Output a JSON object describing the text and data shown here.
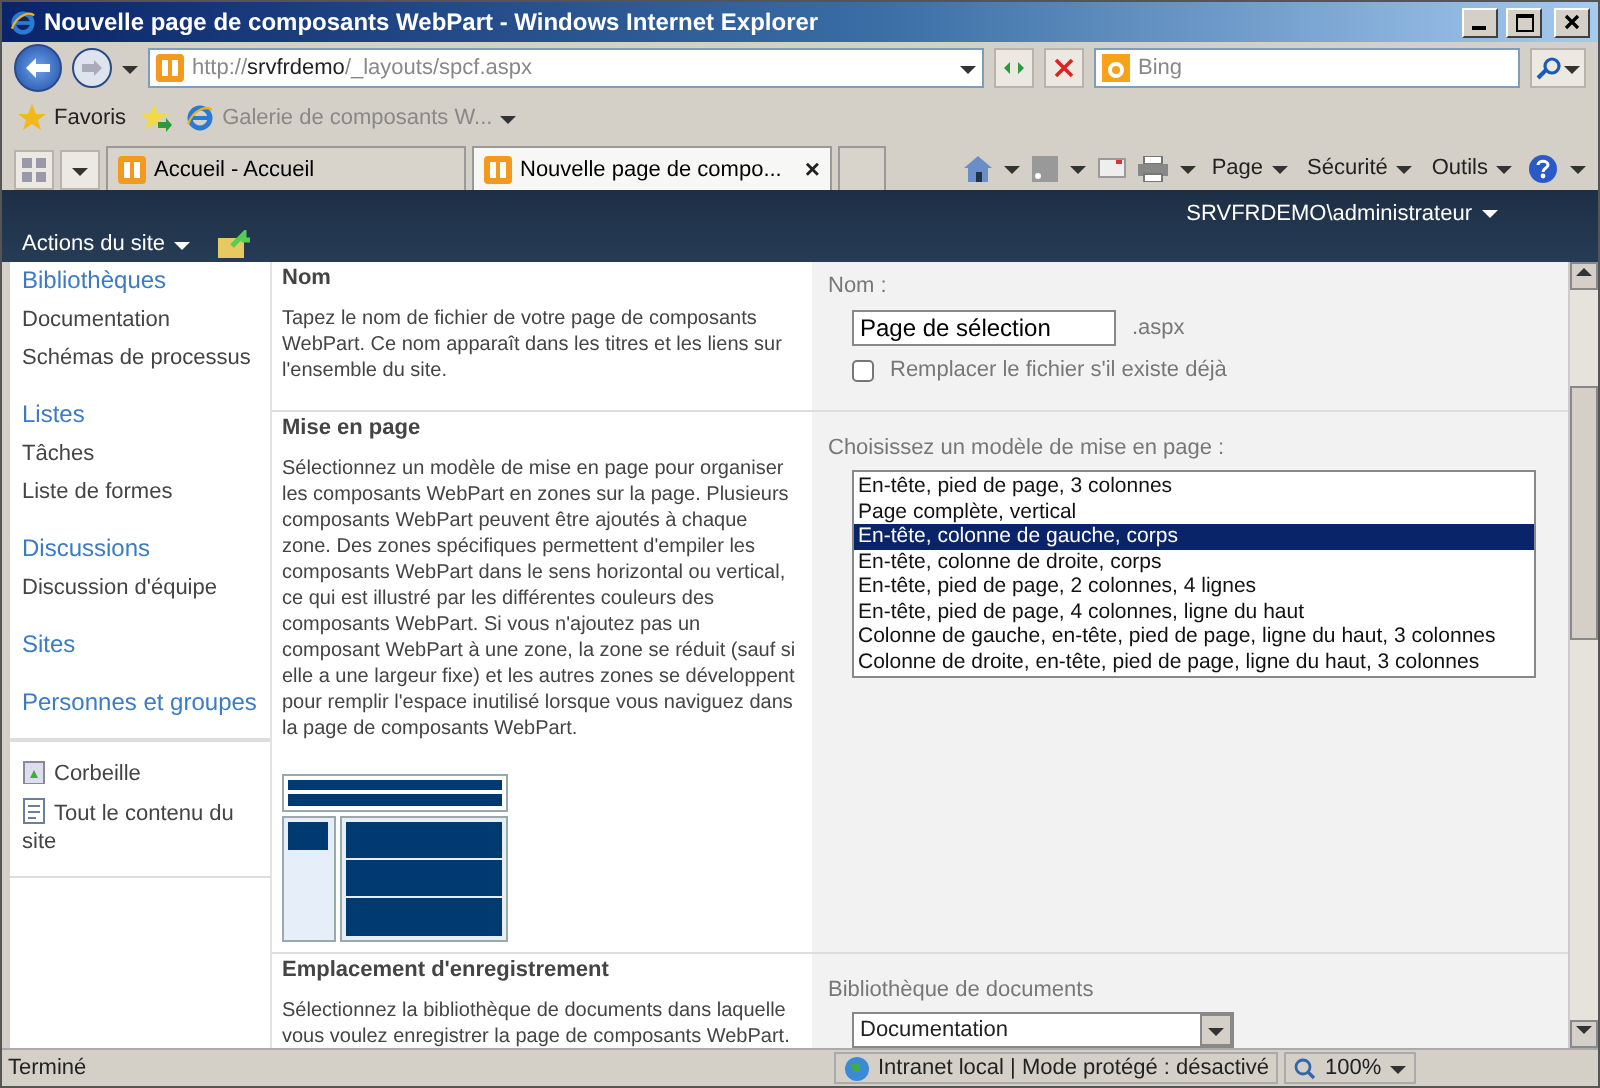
{
  "window": {
    "title": "Nouvelle page de composants WebPart - Windows Internet Explorer"
  },
  "address_bar": {
    "url_prefix": "http://",
    "url_host": "srvfrdemo",
    "url_path": "/_layouts/spcf.aspx",
    "search_placeholder": "Bing"
  },
  "favorites_bar": {
    "label": "Favoris",
    "links": [
      "Galerie de composants W..."
    ]
  },
  "tabs": [
    {
      "label": "Accueil - Accueil",
      "selected": false
    },
    {
      "label": "Nouvelle page de compo...",
      "selected": true,
      "close": "×"
    }
  ],
  "command_bar": {
    "menus": [
      "Page",
      "Sécurité",
      "Outils"
    ]
  },
  "site_header": {
    "user": "SRVFRDEMO\\administrateur",
    "actions": "Actions du site"
  },
  "sidebar": {
    "groups": [
      {
        "heading": "Bibliothèques",
        "items": [
          "Documentation",
          "Schémas de processus"
        ]
      },
      {
        "heading": "Listes",
        "items": [
          "Tâches",
          "Liste de formes"
        ]
      },
      {
        "heading": "Discussions",
        "items": [
          "Discussion d'équipe"
        ]
      },
      {
        "heading": "Sites"
      },
      {
        "heading": "Personnes et groupes"
      }
    ],
    "footer_links": [
      {
        "kind": "recycle",
        "label": "Corbeille"
      },
      {
        "kind": "content",
        "label": "Tout le contenu du site"
      }
    ]
  },
  "sections": [
    {
      "kind": "name",
      "title": "Nom",
      "description": "Tapez le nom de fichier de votre page de composants WebPart. Ce nom apparaît dans les titres et les liens sur l'ensemble du site.",
      "field_label": "Nom :",
      "value": "Page de sélection",
      "suffix": ".aspx",
      "checkbox": {
        "label": "Remplacer le fichier s'il existe déjà",
        "checked": false
      }
    },
    {
      "kind": "layout",
      "title": "Mise en page",
      "description": "Sélectionnez un modèle de mise en page pour organiser les composants WebPart en zones sur la page. Plusieurs composants WebPart peuvent être ajoutés à chaque zone. Des zones spécifiques permettent d'empiler les composants WebPart dans le sens horizontal ou vertical, ce qui est illustré par les différentes couleurs des composants WebPart. Si vous n'ajoutez pas un composant WebPart à une zone, la zone se réduit (sauf si elle a une largeur fixe) et les autres zones se développent pour remplir l'espace inutilisé lorsque vous naviguez dans la page de composants WebPart.",
      "field_label": "Choisissez un modèle de mise en page :",
      "options": [
        {
          "label": "En-tête, pied de page, 3 colonnes",
          "selected": false
        },
        {
          "label": "Page complète, vertical",
          "selected": false
        },
        {
          "label": "En-tête, colonne de gauche, corps",
          "selected": true
        },
        {
          "label": "En-tête, colonne de droite, corps",
          "selected": false
        },
        {
          "label": "En-tête, pied de page, 2 colonnes, 4 lignes",
          "selected": false
        },
        {
          "label": "En-tête, pied de page, 4 colonnes, ligne du haut",
          "selected": false
        },
        {
          "label": "Colonne de gauche, en-tête, pied de page, ligne du haut, 3 colonnes",
          "selected": false
        },
        {
          "label": "Colonne de droite, en-tête, pied de page, ligne du haut, 3 colonnes",
          "selected": false
        }
      ]
    },
    {
      "kind": "location",
      "title": "Emplacement d'enregistrement",
      "description": "Sélectionnez la bibliothèque de documents dans laquelle vous voulez enregistrer la page de composants WebPart.",
      "field_label": "Bibliothèque de documents",
      "value": "Documentation"
    }
  ],
  "status_bar": {
    "text": "Terminé",
    "zone": "Intranet local | Mode protégé : désactivé",
    "zoom": "100%"
  }
}
